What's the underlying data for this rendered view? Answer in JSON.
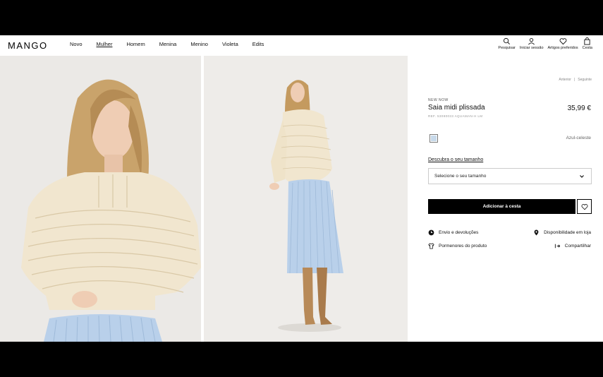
{
  "brand": {
    "logo": "MANGO"
  },
  "nav": {
    "items": [
      "Novo",
      "Mulher",
      "Homem",
      "Menina",
      "Menino",
      "Violeta",
      "Edits"
    ],
    "active": "Mulher"
  },
  "tools": {
    "search": "Pesquisar",
    "login": "Iniciar sessão",
    "favorites": "Artigos preferidos",
    "cart": "Cesta"
  },
  "pager": {
    "prev": "Anterior",
    "next": "Seguinte"
  },
  "product": {
    "kicker": "NEW NOW",
    "name": "Saia midi plissada",
    "price": "35,99 €",
    "ref": "REF. 53080033 AQUAMAN-H LM",
    "color_name": "Azul-celeste",
    "color_hex": "#c7d9ea",
    "size_link": "Descubra o seu tamanho",
    "size_placeholder": "Selecione o seu tamanho",
    "add_to_cart": "Adicionar à cesta"
  },
  "links": {
    "shipping": "Envio e devoluções",
    "store_availability": "Disponibilidade em loja",
    "product_details": "Pormenores do produto",
    "share": "Compartilhar"
  },
  "photos": [
    "model-front-closeup",
    "model-full-length"
  ]
}
